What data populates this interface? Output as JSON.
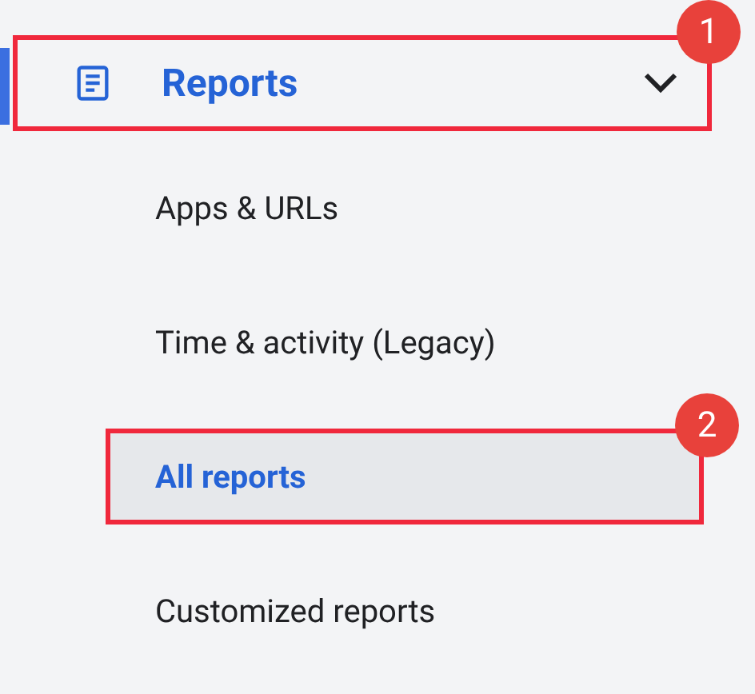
{
  "nav": {
    "label": "Reports",
    "active": true,
    "expanded": true,
    "callout": "1",
    "children": [
      {
        "label": "Apps & URLs",
        "selected": false
      },
      {
        "label": "Time & activity (Legacy)",
        "selected": false
      },
      {
        "label": "All reports",
        "selected": true,
        "callout": "2"
      },
      {
        "label": "Customized reports",
        "selected": false
      }
    ]
  }
}
